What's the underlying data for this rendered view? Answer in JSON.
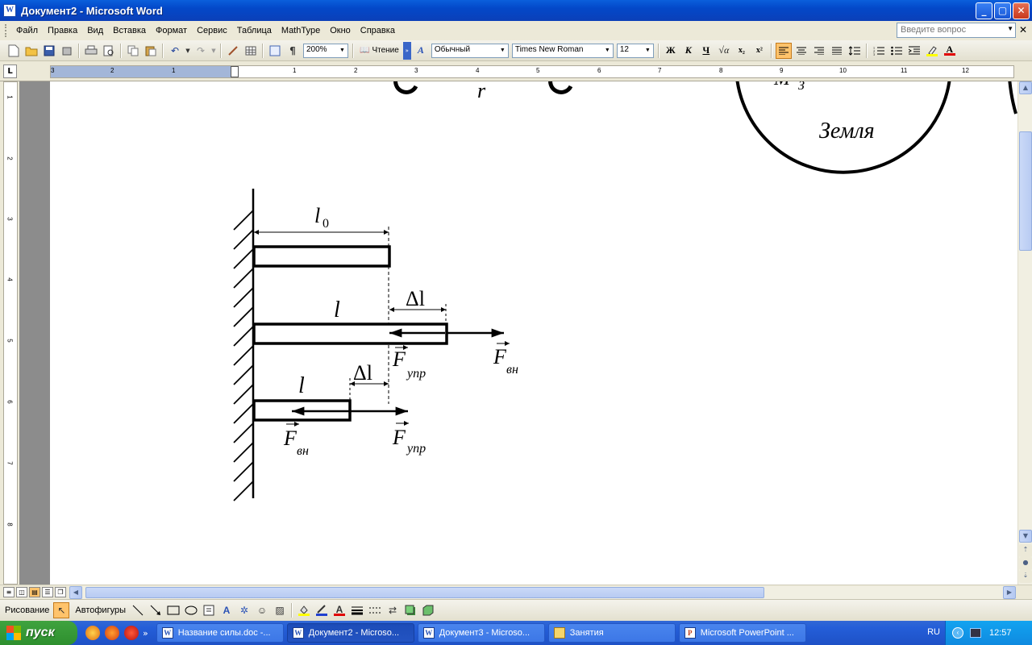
{
  "window": {
    "title": "Документ2 - Microsoft Word",
    "min": "_",
    "max": "▢",
    "close": "✕"
  },
  "menu": {
    "items": [
      "Файл",
      "Правка",
      "Вид",
      "Вставка",
      "Формат",
      "Сервис",
      "Таблица",
      "MathType",
      "Окно",
      "Справка"
    ],
    "help_placeholder": "Введите вопрос"
  },
  "toolbar": {
    "zoom": "200%",
    "read_label": "Чтение",
    "style": "Обычный",
    "font": "Times New Roman",
    "size": "12",
    "bold": "Ж",
    "italic": "К",
    "underline": "Ч",
    "sub": "x₂",
    "sup": "x²"
  },
  "ruler": {
    "ticks_left": [
      "3",
      "2",
      "1"
    ],
    "ticks_right": [
      "1",
      "2",
      "3",
      "4",
      "5",
      "6",
      "7",
      "8",
      "9",
      "10",
      "11",
      "12"
    ],
    "vticks": [
      "1",
      "2",
      "3",
      "4",
      "5",
      "6",
      "7",
      "8"
    ],
    "tab_selector": "L"
  },
  "document": {
    "top_fragment_r": "r",
    "top_fragment_mz": "M",
    "top_fragment_mz_sub": "З",
    "earth_label": "Земля",
    "l0": "l",
    "l0_sub": "0",
    "l": "l",
    "l2": "l",
    "delta_l": "Δl",
    "delta_l2": "Δl",
    "F": "F",
    "sub_upr": "упр",
    "sub_vn": "вн"
  },
  "drawbar": {
    "draw_label": "Рисование",
    "autoshapes_label": "Автофигуры"
  },
  "taskbar": {
    "start_label": "пуск",
    "tasks": [
      {
        "label": "Название силы.doc -...",
        "icon": "W"
      },
      {
        "label": "Документ2 - Microso...",
        "icon": "W"
      },
      {
        "label": "Документ3 - Microso...",
        "icon": "W"
      },
      {
        "label": "Занятия",
        "icon": ""
      },
      {
        "label": "Microsoft PowerPoint ...",
        "icon": "P"
      }
    ],
    "lang": "RU",
    "clock": "12:57"
  },
  "colors": {
    "title_bar": "#0348c8",
    "taskbar": "#245ed8",
    "start": "#2e8f2e",
    "tray": "#0f8ae0",
    "active_btn": "#ffc36b"
  }
}
